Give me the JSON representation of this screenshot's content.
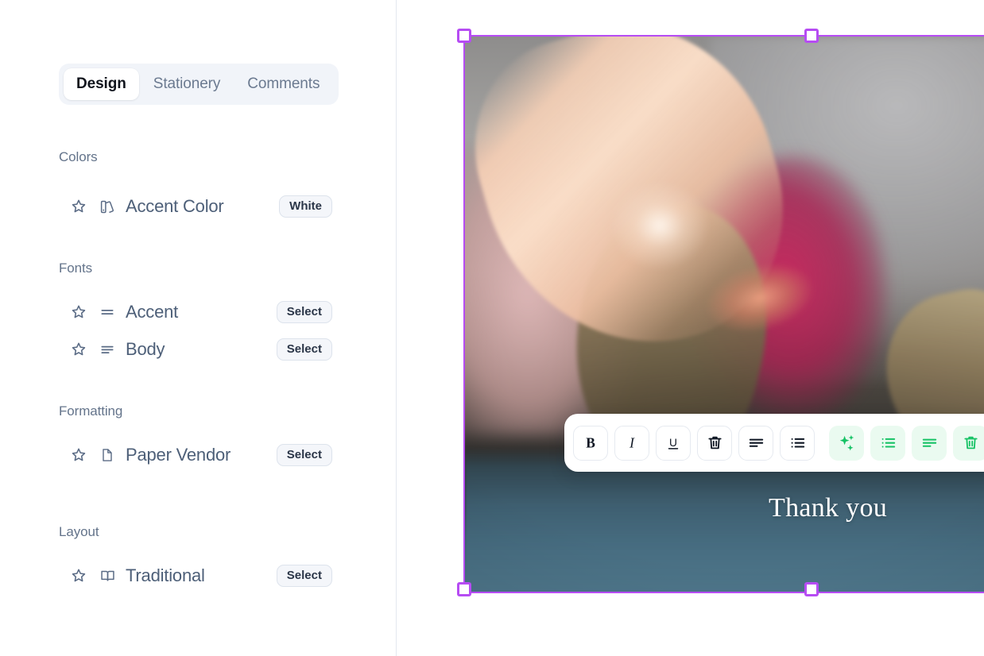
{
  "panel": {
    "tabs": [
      {
        "label": "Design",
        "active": true
      },
      {
        "label": "Stationery",
        "active": false
      },
      {
        "label": "Comments",
        "active": false
      }
    ],
    "sections": [
      {
        "title": "Colors",
        "rows": [
          {
            "icon": "color-swatch-icon",
            "label": "Accent Color",
            "action": "White"
          }
        ]
      },
      {
        "title": "Fonts",
        "rows": [
          {
            "icon": "text-lines-two-icon",
            "label": "Accent",
            "action": "Select"
          },
          {
            "icon": "text-lines-three-icon",
            "label": "Body",
            "action": "Select"
          }
        ]
      },
      {
        "title": "Formatting",
        "rows": [
          {
            "icon": "document-icon",
            "label": "Paper Vendor",
            "action": "Select"
          }
        ]
      },
      {
        "title": "Layout",
        "rows": [
          {
            "icon": "open-book-icon",
            "label": "Traditional",
            "action": "Select"
          }
        ]
      }
    ],
    "favorite_icon": "star-icon"
  },
  "canvas": {
    "card_text": "Thank you",
    "selection_color": "#b64cf3",
    "image_alt": "hand high-fiving a tabby cat paw",
    "handles": [
      "top-left",
      "top-middle",
      "bottom-left",
      "bottom-middle"
    ]
  },
  "toolbar": {
    "buttons": [
      {
        "name": "bold-button",
        "icon": "bold-icon",
        "group": "dark"
      },
      {
        "name": "italic-button",
        "icon": "italic-icon",
        "group": "dark"
      },
      {
        "name": "underline-button",
        "icon": "underline-icon",
        "group": "dark"
      },
      {
        "name": "delete-button",
        "icon": "trash-icon",
        "group": "dark"
      },
      {
        "name": "align-left-button",
        "icon": "align-left-icon",
        "group": "dark"
      },
      {
        "name": "bulleted-list-button",
        "icon": "bulleted-list-icon",
        "group": "dark"
      },
      {
        "name": "ai-magic-button",
        "icon": "sparkles-icon",
        "group": "green"
      },
      {
        "name": "ai-bulleted-list-button",
        "icon": "bulleted-list-icon",
        "group": "green"
      },
      {
        "name": "ai-align-left-button",
        "icon": "align-left-icon",
        "group": "green"
      },
      {
        "name": "ai-delete-button",
        "icon": "trash-icon",
        "group": "green"
      }
    ],
    "accent_color": "#16c265"
  }
}
